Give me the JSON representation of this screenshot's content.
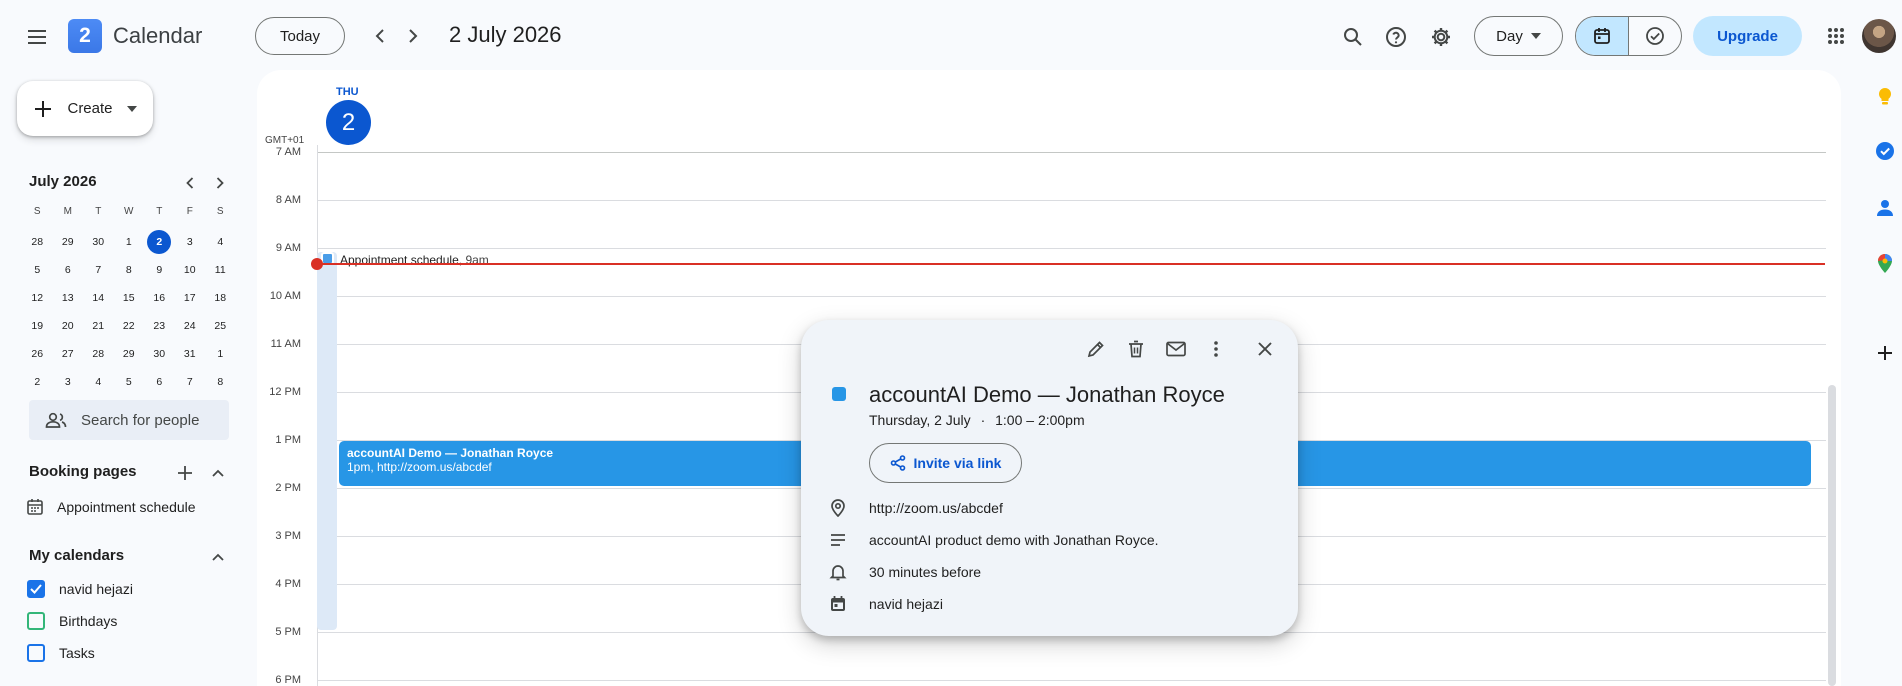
{
  "header": {
    "app_title": "Calendar",
    "logo_text": "2",
    "today_label": "Today",
    "date_title": "2 July 2026",
    "view_label": "Day",
    "upgrade_label": "Upgrade"
  },
  "sidebar": {
    "create_label": "Create",
    "mini_month": "July 2026",
    "dow": [
      "S",
      "M",
      "T",
      "W",
      "T",
      "F",
      "S"
    ],
    "weeks": [
      [
        "28",
        "29",
        "30",
        "1",
        "2",
        "3",
        "4"
      ],
      [
        "5",
        "6",
        "7",
        "8",
        "9",
        "10",
        "11"
      ],
      [
        "12",
        "13",
        "14",
        "15",
        "16",
        "17",
        "18"
      ],
      [
        "19",
        "20",
        "21",
        "22",
        "23",
        "24",
        "25"
      ],
      [
        "26",
        "27",
        "28",
        "29",
        "30",
        "31",
        "1"
      ],
      [
        "2",
        "3",
        "4",
        "5",
        "6",
        "7",
        "8"
      ]
    ],
    "selected_day": "2",
    "search_people_placeholder": "Search for people",
    "booking_title": "Booking pages",
    "booking_item": "Appointment schedule",
    "my_calendars_title": "My calendars",
    "calendars": [
      {
        "name": "navid hejazi",
        "checked": true,
        "color": "#1a73e8"
      },
      {
        "name": "Birthdays",
        "checked": false,
        "color": "#33b679"
      },
      {
        "name": "Tasks",
        "checked": false,
        "color": "#1a73e8"
      }
    ]
  },
  "main": {
    "dow": "THU",
    "day_number": "2",
    "timezone": "GMT+01",
    "hours": [
      "7 AM",
      "8 AM",
      "9 AM",
      "10 AM",
      "11 AM",
      "12 PM",
      "1 PM",
      "2 PM",
      "3 PM",
      "4 PM",
      "5 PM",
      "6 PM"
    ],
    "appointment_title": "Appointment schedule,",
    "appointment_time": "9am",
    "event_title": "accountAI Demo — Jonathan Royce",
    "event_detail": "1pm, http://zoom.us/abcdef"
  },
  "popup": {
    "title": "accountAI Demo — Jonathan Royce",
    "date": "Thursday, 2 July",
    "separator": "·",
    "time": "1:00 – 2:00pm",
    "invite_label": "Invite via link",
    "location": "http://zoom.us/abcdef",
    "description": "accountAI product demo with Jonathan Royce.",
    "reminder": "30 minutes before",
    "calendar": "navid hejazi"
  },
  "colors": {
    "accent": "#0b57d0",
    "event": "#2796e6",
    "now_line": "#d93025"
  }
}
